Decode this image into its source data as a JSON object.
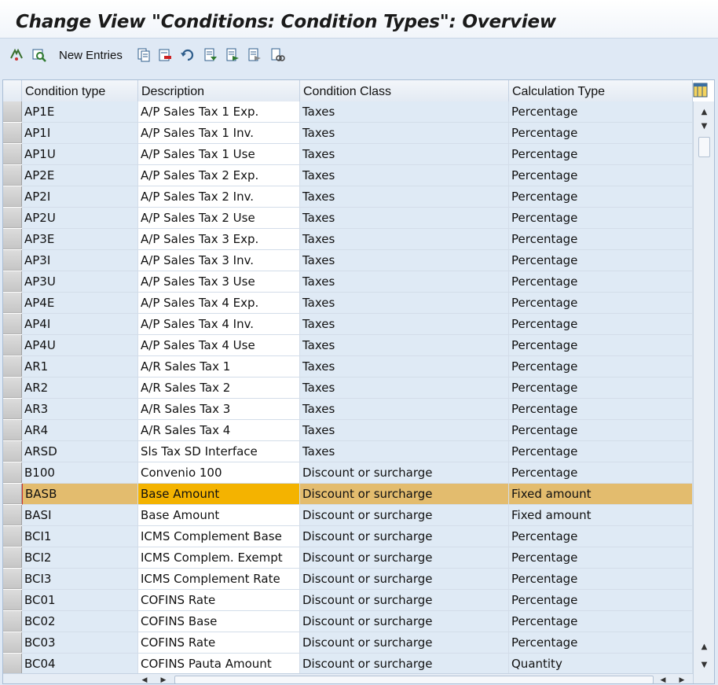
{
  "window": {
    "title": "Change View \"Conditions: Condition Types\": Overview"
  },
  "toolbar": {
    "new_entries_label": "New Entries"
  },
  "table": {
    "columns": [
      "Condition type",
      "Description",
      "Condition Class",
      "Calculation Type"
    ],
    "selected_row_index": 18,
    "rows": [
      [
        "AP1E",
        "A/P Sales Tax 1 Exp.",
        "Taxes",
        "Percentage"
      ],
      [
        "AP1I",
        "A/P Sales Tax 1 Inv.",
        "Taxes",
        "Percentage"
      ],
      [
        "AP1U",
        "A/P Sales Tax 1 Use",
        "Taxes",
        "Percentage"
      ],
      [
        "AP2E",
        "A/P Sales Tax 2 Exp.",
        "Taxes",
        "Percentage"
      ],
      [
        "AP2I",
        "A/P Sales Tax 2 Inv.",
        "Taxes",
        "Percentage"
      ],
      [
        "AP2U",
        "A/P Sales Tax 2 Use",
        "Taxes",
        "Percentage"
      ],
      [
        "AP3E",
        "A/P Sales Tax 3 Exp.",
        "Taxes",
        "Percentage"
      ],
      [
        "AP3I",
        "A/P Sales Tax 3 Inv.",
        "Taxes",
        "Percentage"
      ],
      [
        "AP3U",
        "A/P Sales Tax 3 Use",
        "Taxes",
        "Percentage"
      ],
      [
        "AP4E",
        "A/P Sales Tax 4 Exp.",
        "Taxes",
        "Percentage"
      ],
      [
        "AP4I",
        "A/P Sales Tax 4 Inv.",
        "Taxes",
        "Percentage"
      ],
      [
        "AP4U",
        "A/P Sales Tax 4 Use",
        "Taxes",
        "Percentage"
      ],
      [
        "AR1",
        "A/R Sales Tax 1",
        "Taxes",
        "Percentage"
      ],
      [
        "AR2",
        "A/R Sales Tax 2",
        "Taxes",
        "Percentage"
      ],
      [
        "AR3",
        "A/R Sales Tax 3",
        "Taxes",
        "Percentage"
      ],
      [
        "AR4",
        "A/R Sales Tax 4",
        "Taxes",
        "Percentage"
      ],
      [
        "ARSD",
        "Sls Tax SD Interface",
        "Taxes",
        "Percentage"
      ],
      [
        "B100",
        "Convenio 100",
        "Discount or surcharge",
        "Percentage"
      ],
      [
        "BASB",
        "Base Amount",
        "Discount or surcharge",
        "Fixed amount"
      ],
      [
        "BASI",
        "Base Amount",
        "Discount or surcharge",
        "Fixed amount"
      ],
      [
        "BCI1",
        "ICMS Complement Base",
        "Discount or surcharge",
        "Percentage"
      ],
      [
        "BCI2",
        "ICMS Complem. Exempt",
        "Discount or surcharge",
        "Percentage"
      ],
      [
        "BCI3",
        "ICMS Complement Rate",
        "Discount or surcharge",
        "Percentage"
      ],
      [
        "BC01",
        "COFINS Rate",
        "Discount or surcharge",
        "Percentage"
      ],
      [
        "BC02",
        "COFINS Base",
        "Discount or surcharge",
        "Percentage"
      ],
      [
        "BC03",
        "COFINS Rate",
        "Discount or surcharge",
        "Percentage"
      ],
      [
        "BC04",
        "COFINS Pauta Amount",
        "Discount or surcharge",
        "Quantity"
      ]
    ]
  },
  "colors": {
    "selected_row": "#f4b300",
    "selected_row_other": "#e3bc6e",
    "key_column": "#dfeaf5"
  }
}
